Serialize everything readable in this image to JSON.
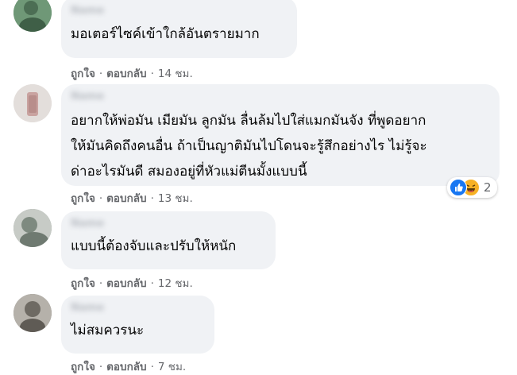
{
  "comments": [
    {
      "text": "มอเตอร์ไซค์เข้าใกล้อันตรายมาก",
      "actions": {
        "like": "ถูกใจ",
        "reply": "ตอบกลับ",
        "time": "14 ชม."
      },
      "avatar_color": "#5f8c68"
    },
    {
      "text": "อยากให้พ่อมัน เมียมัน ลูกมัน ลื่นล้มไปใส่แมกมันจัง ที่พูดอยาก\nให้มันคิดถึงคนอื่น ถ้าเป็นญาติมันไปโดนจะรู้สึกอย่างไร ไม่รู้จะ\nด่าอะไรมันดี สมองอยู่ที่หัวแม่ตีนมั้งแบบนี้",
      "actions": {
        "like": "ถูกใจ",
        "reply": "ตอบกลับ",
        "time": "13 ชม."
      },
      "avatar_color": "#d7d2ce",
      "reactions": {
        "icons": [
          "like-icon",
          "haha-icon"
        ],
        "count": "2"
      }
    },
    {
      "text": "แบบนี้ต้องจับและปรับให้หนัก",
      "actions": {
        "like": "ถูกใจ",
        "reply": "ตอบกลับ",
        "time": "12 ชม."
      },
      "avatar_color": "#9aa39c"
    },
    {
      "text": "ไม่สมควรนะ",
      "actions": {
        "like": "ถูกใจ",
        "reply": "ตอบกลับ",
        "time": "7 ชม."
      },
      "avatar_color": "#8e8c86"
    }
  ],
  "colors": {
    "bubble": "#f0f2f5",
    "meta_text": "#65676b",
    "like_blue": "#1877f2",
    "haha_yellow": "#f7b125"
  }
}
